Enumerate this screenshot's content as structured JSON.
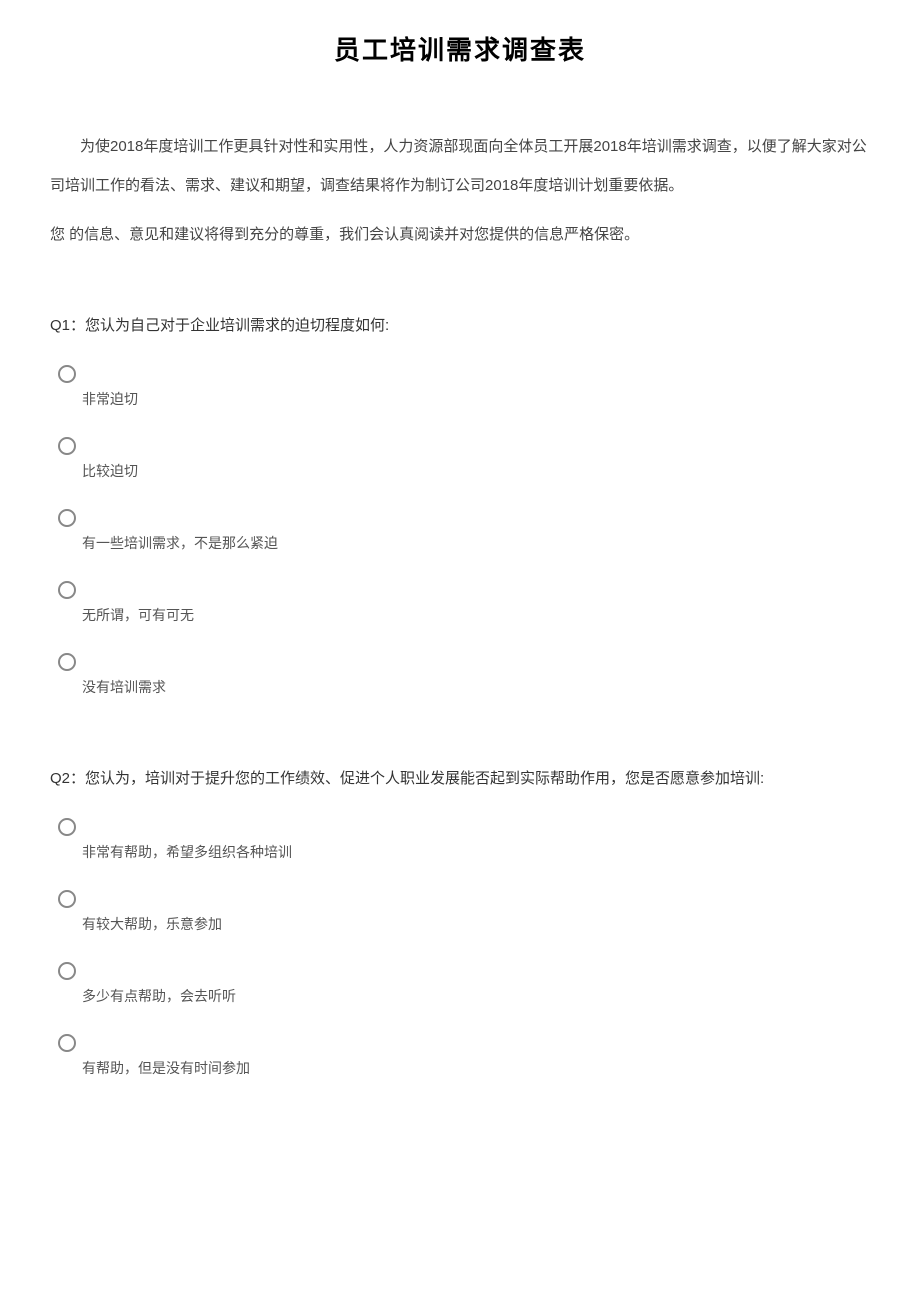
{
  "title": "员工培训需求调查表",
  "intro": "为使2018年度培训工作更具针对性和实用性，人力资源部现面向全体员工开展2018年培训需求调查，以便了解大家对公司培训工作的看法、需求、建议和期望，调查结果将作为制订公司2018年度培训计划重要依据。",
  "intro_note": "您 的信息、意见和建议将得到充分的尊重，我们会认真阅读并对您提供的信息严格保密。",
  "q1": {
    "prompt": "Q1：您认为自己对于企业培训需求的迫切程度如何:",
    "opts": [
      "非常迫切",
      "比较迫切",
      "有一些培训需求，不是那么紧迫",
      "无所谓，可有可无",
      "没有培训需求"
    ]
  },
  "q2": {
    "prompt": "Q2：您认为，培训对于提升您的工作绩效、促进个人职业发展能否起到实际帮助作用，您是否愿意参加培训:",
    "opts": [
      "非常有帮助，希望多组织各种培训",
      "有较大帮助，乐意参加",
      "多少有点帮助，会去听听",
      "有帮助，但是没有时间参加"
    ]
  }
}
